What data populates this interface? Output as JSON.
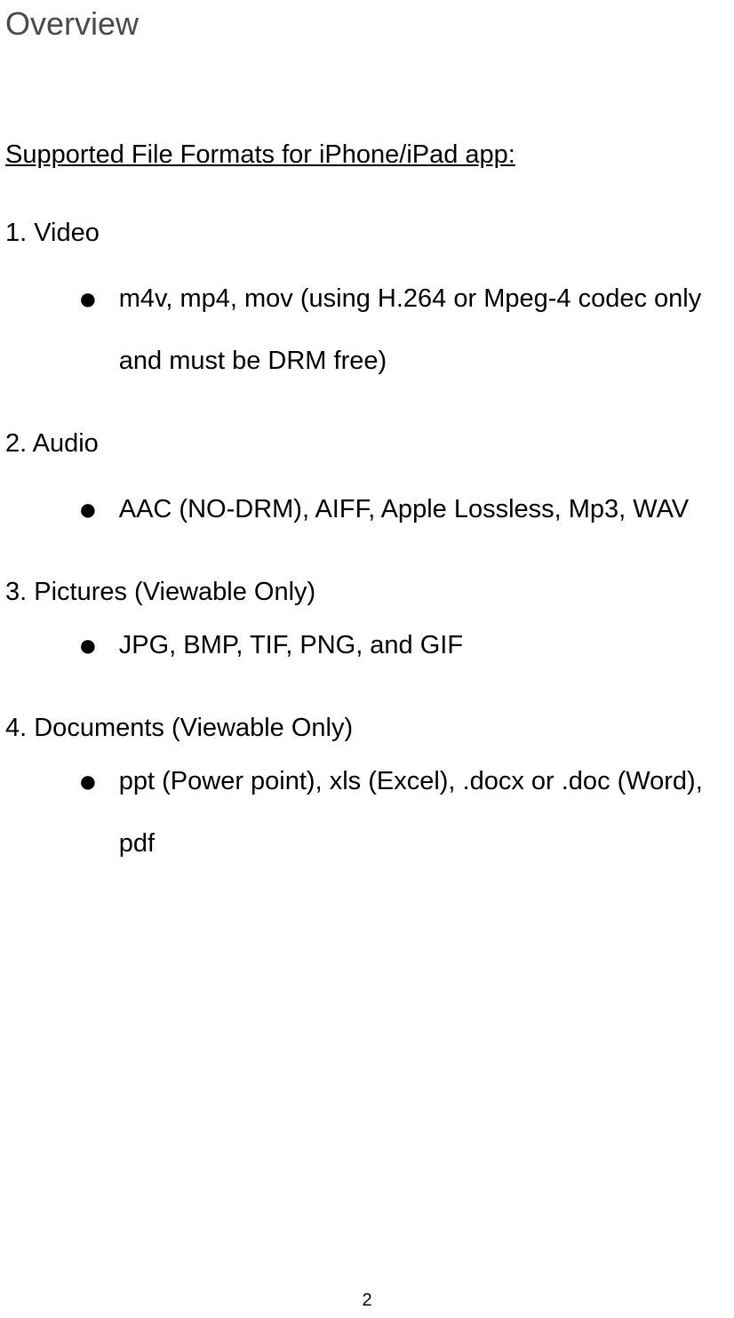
{
  "title": "Overview",
  "subtitle": "Supported File Formats for iPhone/iPad app:  ",
  "sections": [
    {
      "heading": "1. Video",
      "bullet": "m4v, mp4, mov (using H.264 or Mpeg-4 codec only and must be DRM free)"
    },
    {
      "heading": "2. Audio",
      "bullet": "AAC (NO-DRM), AIFF, Apple Lossless, Mp3, WAV"
    },
    {
      "heading": "3. Pictures (Viewable Only)",
      "bullet": "JPG, BMP, TIF, PNG, and GIF"
    },
    {
      "heading": "4. Documents (Viewable Only)",
      "bullet": "ppt (Power point), xls (Excel), .docx or .doc (Word), pdf"
    }
  ],
  "bullet_glyph": "●",
  "page_number": "2"
}
